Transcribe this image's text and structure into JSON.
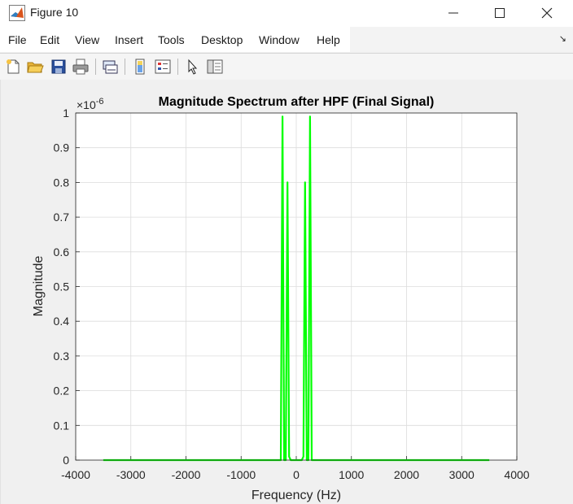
{
  "window": {
    "title": "Figure 10"
  },
  "menu": [
    "File",
    "Edit",
    "View",
    "Insert",
    "Tools",
    "Desktop",
    "Window",
    "Help"
  ],
  "toolbar": {
    "buttons": [
      "new-figure",
      "open-file",
      "save",
      "print",
      "link-plot",
      "insert-colorbar",
      "insert-legend",
      "edit-plot",
      "property-inspector"
    ]
  },
  "colors": {
    "line": "#00ff00",
    "axes_bg": "#ffffff",
    "figure_bg": "#f0f0f0"
  },
  "chart_data": {
    "type": "line",
    "title": "Magnitude Spectrum after HPF (Final Signal)",
    "xlabel": "Frequency (Hz)",
    "ylabel": "Magnitude",
    "exponent_label": "×10",
    "exponent_power": "-6",
    "xlim": [
      -4000,
      4000
    ],
    "ylim": [
      0,
      1
    ],
    "xticks": [
      "-4000",
      "-3000",
      "-2000",
      "-1000",
      "0",
      "1000",
      "2000",
      "3000",
      "4000"
    ],
    "yticks": [
      "0",
      "0.1",
      "0.2",
      "0.3",
      "0.4",
      "0.5",
      "0.6",
      "0.7",
      "0.8",
      "0.9",
      "1"
    ],
    "grid": true,
    "series": [
      {
        "x": [
          -3500,
          -280,
          -250,
          -220,
          -190,
          -160,
          -130,
          -100,
          -60,
          0,
          60,
          100,
          130,
          160,
          190,
          220,
          250,
          280,
          3500
        ],
        "y": [
          0,
          0,
          0.99,
          0.0,
          0.0,
          0.8,
          0.01,
          0.0,
          0.0,
          0.0,
          0.0,
          0.0,
          0.01,
          0.8,
          0.0,
          0.0,
          0.99,
          0,
          0
        ]
      }
    ]
  }
}
